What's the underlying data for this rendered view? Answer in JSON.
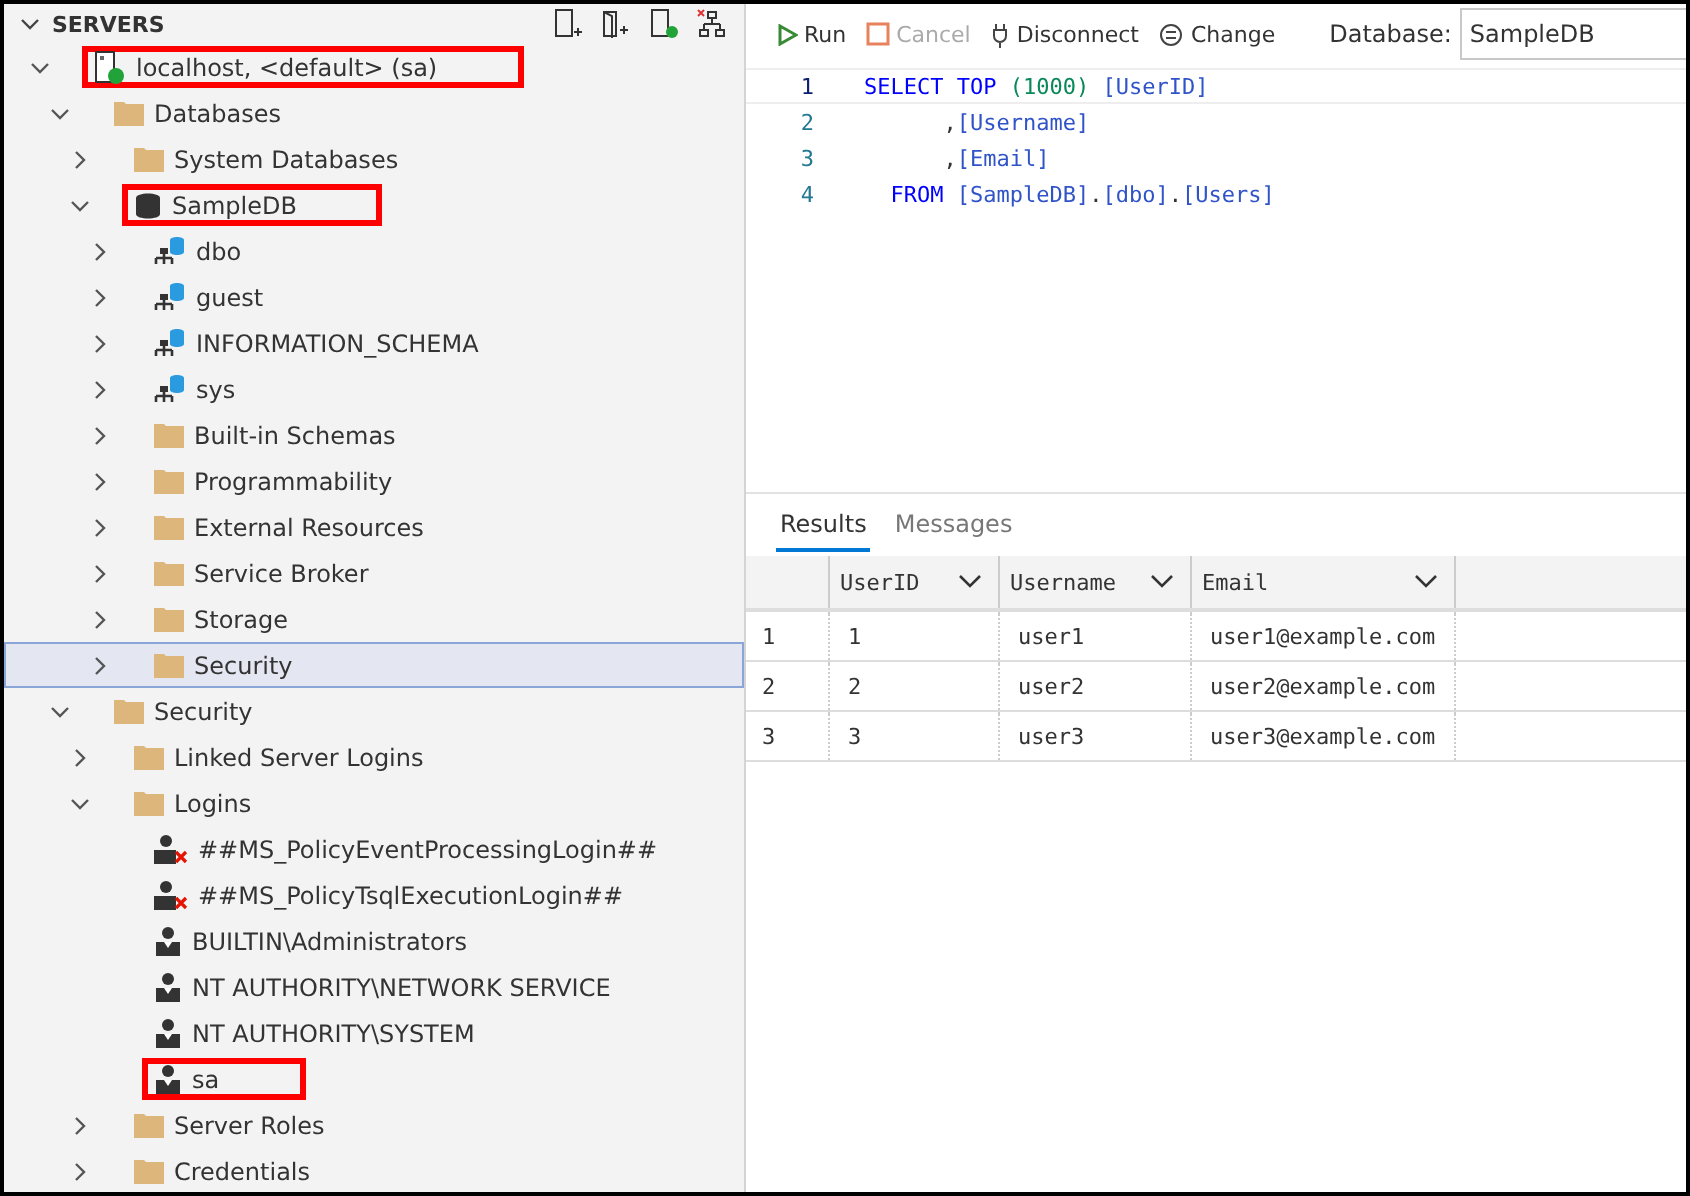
{
  "sidebar": {
    "title": "SERVERS",
    "expanded": true,
    "tree": [
      {
        "label": "localhost, <default> (sa)",
        "kind": "server",
        "expanded": true,
        "selected": false,
        "annotated": true,
        "children": [
          {
            "label": "Databases",
            "kind": "folder",
            "expanded": true,
            "selected": false,
            "annotated": false,
            "children": [
              {
                "label": "System Databases",
                "kind": "folder",
                "expanded": false,
                "selected": false,
                "annotated": false
              },
              {
                "label": "SampleDB",
                "kind": "database",
                "expanded": true,
                "selected": false,
                "annotated": true,
                "children": [
                  {
                    "label": "dbo",
                    "kind": "schema",
                    "expanded": false,
                    "selected": false,
                    "annotated": false
                  },
                  {
                    "label": "guest",
                    "kind": "schema",
                    "expanded": false,
                    "selected": false,
                    "annotated": false
                  },
                  {
                    "label": "INFORMATION_SCHEMA",
                    "kind": "schema",
                    "expanded": false,
                    "selected": false,
                    "annotated": false
                  },
                  {
                    "label": "sys",
                    "kind": "schema",
                    "expanded": false,
                    "selected": false,
                    "annotated": false
                  },
                  {
                    "label": "Built-in Schemas",
                    "kind": "folder",
                    "expanded": false,
                    "selected": false,
                    "annotated": false
                  },
                  {
                    "label": "Programmability",
                    "kind": "folder",
                    "expanded": false,
                    "selected": false,
                    "annotated": false
                  },
                  {
                    "label": "External Resources",
                    "kind": "folder",
                    "expanded": false,
                    "selected": false,
                    "annotated": false
                  },
                  {
                    "label": "Service Broker",
                    "kind": "folder",
                    "expanded": false,
                    "selected": false,
                    "annotated": false
                  },
                  {
                    "label": "Storage",
                    "kind": "folder",
                    "expanded": false,
                    "selected": false,
                    "annotated": false
                  },
                  {
                    "label": "Security",
                    "kind": "folder",
                    "expanded": false,
                    "selected": true,
                    "annotated": false
                  }
                ]
              }
            ]
          },
          {
            "label": "Security",
            "kind": "folder",
            "expanded": true,
            "selected": false,
            "annotated": false,
            "children": [
              {
                "label": "Linked Server Logins",
                "kind": "folder",
                "expanded": false,
                "selected": false,
                "annotated": false
              },
              {
                "label": "Logins",
                "kind": "folder",
                "expanded": true,
                "selected": false,
                "annotated": false,
                "children": [
                  {
                    "label": "##MS_PolicyEventProcessingLogin##",
                    "kind": "login_disabled",
                    "selected": false,
                    "annotated": false
                  },
                  {
                    "label": "##MS_PolicyTsqlExecutionLogin##",
                    "kind": "login_disabled",
                    "selected": false,
                    "annotated": false
                  },
                  {
                    "label": "BUILTIN\\Administrators",
                    "kind": "login",
                    "selected": false,
                    "annotated": false
                  },
                  {
                    "label": "NT AUTHORITY\\NETWORK SERVICE",
                    "kind": "login",
                    "selected": false,
                    "annotated": false
                  },
                  {
                    "label": "NT AUTHORITY\\SYSTEM",
                    "kind": "login",
                    "selected": false,
                    "annotated": false
                  },
                  {
                    "label": "sa",
                    "kind": "login",
                    "selected": false,
                    "annotated": true
                  }
                ]
              },
              {
                "label": "Server Roles",
                "kind": "folder",
                "expanded": false,
                "selected": false,
                "annotated": false
              },
              {
                "label": "Credentials",
                "kind": "folder",
                "expanded": false,
                "selected": false,
                "annotated": false
              }
            ]
          }
        ]
      }
    ]
  },
  "editor": {
    "toolbar": {
      "buttons": [
        {
          "label": "Run",
          "kind": "run",
          "disabled": false
        },
        {
          "label": "Cancel",
          "kind": "cancel",
          "disabled": true
        },
        {
          "label": "Disconnect",
          "kind": "disconnect",
          "disabled": false
        },
        {
          "label": "Change",
          "kind": "change",
          "disabled": false
        }
      ],
      "database_label": "Database:",
      "database_value": "SampleDB"
    },
    "code": [
      {
        "number": "1",
        "current": true,
        "tokens": [
          {
            "text": "SELECT TOP ",
            "kind": "keyword"
          },
          {
            "text": "(1000) ",
            "kind": "number"
          },
          {
            "text": "[UserID]",
            "kind": "identifier"
          }
        ]
      },
      {
        "number": "2",
        "current": false,
        "tokens": [
          {
            "text": "      ,",
            "kind": "punct"
          },
          {
            "text": "[Username]",
            "kind": "identifier"
          }
        ]
      },
      {
        "number": "3",
        "current": false,
        "tokens": [
          {
            "text": "      ,",
            "kind": "punct"
          },
          {
            "text": "[Email]",
            "kind": "identifier"
          }
        ]
      },
      {
        "number": "4",
        "current": false,
        "tokens": [
          {
            "text": "  FROM ",
            "kind": "keyword"
          },
          {
            "text": "[SampleDB]",
            "kind": "identifier"
          },
          {
            "text": ".",
            "kind": "punct"
          },
          {
            "text": "[dbo]",
            "kind": "identifier"
          },
          {
            "text": ".",
            "kind": "punct"
          },
          {
            "text": "[Users]",
            "kind": "identifier"
          }
        ]
      }
    ]
  },
  "results": {
    "tabs": [
      {
        "label": "Results",
        "selected": true
      },
      {
        "label": "Messages",
        "selected": false
      }
    ],
    "columns": [
      "UserID",
      "Username",
      "Email"
    ],
    "rows": [
      {
        "number": "1",
        "cells": [
          "1",
          "user1",
          "user1@example.com"
        ]
      },
      {
        "number": "2",
        "cells": [
          "2",
          "user2",
          "user2@example.com"
        ]
      },
      {
        "number": "3",
        "cells": [
          "3",
          "user3",
          "user3@example.com"
        ]
      }
    ]
  }
}
